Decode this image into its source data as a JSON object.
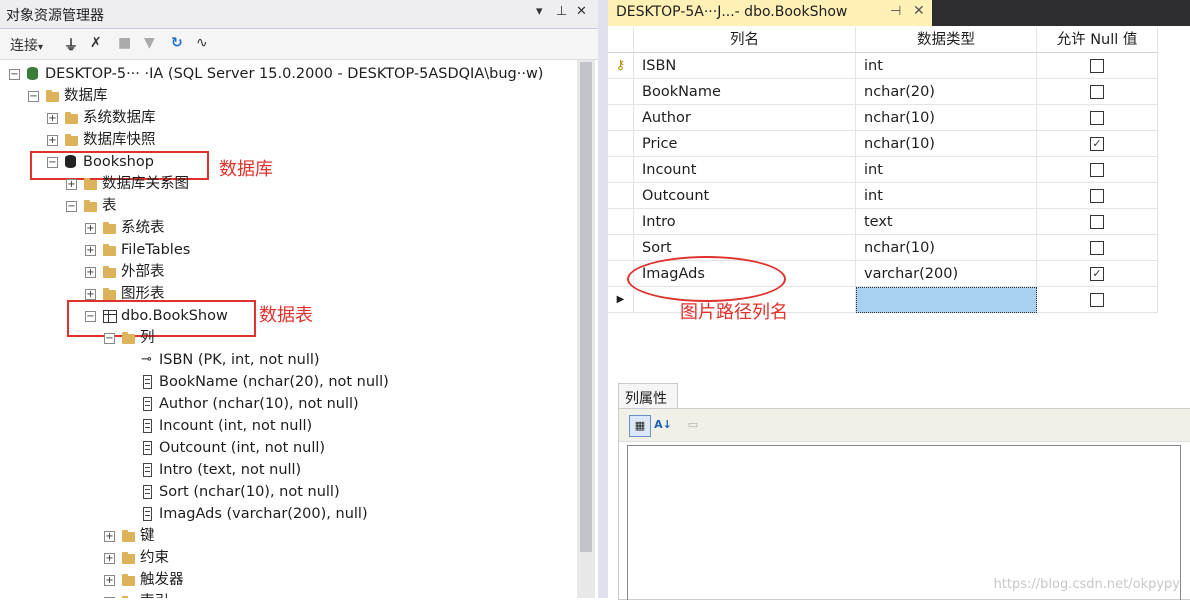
{
  "explorer": {
    "title": "对象资源管理器",
    "title_controls": [
      "▾",
      "ꟷ",
      "✕"
    ],
    "toolbar": {
      "connect_label": "连接",
      "connect_arrow": "▾"
    },
    "tree": [
      {
        "label": "DESKTOP-5··· ·IA (SQL Server 15.0.2000 - DESKTOP-5ASDQIA\\bug··w)",
        "indent": 0,
        "icon": "server",
        "exp": "−"
      },
      {
        "label": "数据库",
        "indent": 1,
        "icon": "folder",
        "exp": "−"
      },
      {
        "label": "系统数据库",
        "indent": 2,
        "icon": "folder",
        "exp": "+"
      },
      {
        "label": "数据库快照",
        "indent": 2,
        "icon": "folder",
        "exp": "+"
      },
      {
        "label": "Bookshop",
        "indent": 2,
        "icon": "db",
        "exp": "−"
      },
      {
        "label": "数据库关系图",
        "indent": 3,
        "icon": "folder",
        "exp": "+"
      },
      {
        "label": "表",
        "indent": 3,
        "icon": "folder",
        "exp": "−"
      },
      {
        "label": "系统表",
        "indent": 4,
        "icon": "folder",
        "exp": "+"
      },
      {
        "label": "FileTables",
        "indent": 4,
        "icon": "folder",
        "exp": "+"
      },
      {
        "label": "外部表",
        "indent": 4,
        "icon": "folder",
        "exp": "+"
      },
      {
        "label": "图形表",
        "indent": 4,
        "icon": "folder",
        "exp": "+"
      },
      {
        "label": "dbo.BookShow",
        "indent": 4,
        "icon": "table",
        "exp": "−"
      },
      {
        "label": "列",
        "indent": 5,
        "icon": "folder",
        "exp": "−"
      },
      {
        "label": "ISBN (PK, int, not null)",
        "indent": 6,
        "icon": "key",
        "exp": ""
      },
      {
        "label": "BookName (nchar(20), not null)",
        "indent": 6,
        "icon": "column",
        "exp": ""
      },
      {
        "label": "Author (nchar(10), not null)",
        "indent": 6,
        "icon": "column",
        "exp": ""
      },
      {
        "label": "Incount (int, not null)",
        "indent": 6,
        "icon": "column",
        "exp": ""
      },
      {
        "label": "Outcount (int, not null)",
        "indent": 6,
        "icon": "column",
        "exp": ""
      },
      {
        "label": "Intro (text, not null)",
        "indent": 6,
        "icon": "column",
        "exp": ""
      },
      {
        "label": "Sort (nchar(10), not null)",
        "indent": 6,
        "icon": "column",
        "exp": ""
      },
      {
        "label": "ImagAds (varchar(200), null)",
        "indent": 6,
        "icon": "column",
        "exp": ""
      },
      {
        "label": "键",
        "indent": 5,
        "icon": "folder",
        "exp": "+"
      },
      {
        "label": "约束",
        "indent": 5,
        "icon": "folder",
        "exp": "+"
      },
      {
        "label": "触发器",
        "indent": 5,
        "icon": "folder",
        "exp": "+"
      },
      {
        "label": "索引",
        "indent": 5,
        "icon": "folder",
        "exp": "+"
      }
    ],
    "annotations": {
      "database": "数据库",
      "table": "数据表"
    }
  },
  "designer": {
    "tab_title": "DESKTOP-5A···J...- dbo.BookShow",
    "tab_pin": "ꟷ",
    "tab_close": "✕",
    "headers": {
      "name": "列名",
      "type": "数据类型",
      "nulls": "允许 Null 值"
    },
    "rows": [
      {
        "name": "ISBN",
        "type": "int",
        "allow_null": false,
        "pk": true
      },
      {
        "name": "BookName",
        "type": "nchar(20)",
        "allow_null": false
      },
      {
        "name": "Author",
        "type": "nchar(10)",
        "allow_null": false
      },
      {
        "name": "Price",
        "type": "nchar(10)",
        "allow_null": true
      },
      {
        "name": "Incount",
        "type": "int",
        "allow_null": false
      },
      {
        "name": "Outcount",
        "type": "int",
        "allow_null": false
      },
      {
        "name": "Intro",
        "type": "text",
        "allow_null": false
      },
      {
        "name": "Sort",
        "type": "nchar(10)",
        "allow_null": false
      },
      {
        "name": "ImagAds",
        "type": "varchar(200)",
        "allow_null": true
      },
      {
        "name": "",
        "type": "",
        "allow_null": false,
        "new_row": true
      }
    ],
    "annotation": "图片路径列名",
    "props_tab": "列属性"
  },
  "watermark": "https://blog.csdn.net/okpypy",
  "colors": {
    "annotation_red": "#e0322d",
    "tab_yellow": "#fff1b6",
    "selected_cell": "#a8d0f0"
  }
}
